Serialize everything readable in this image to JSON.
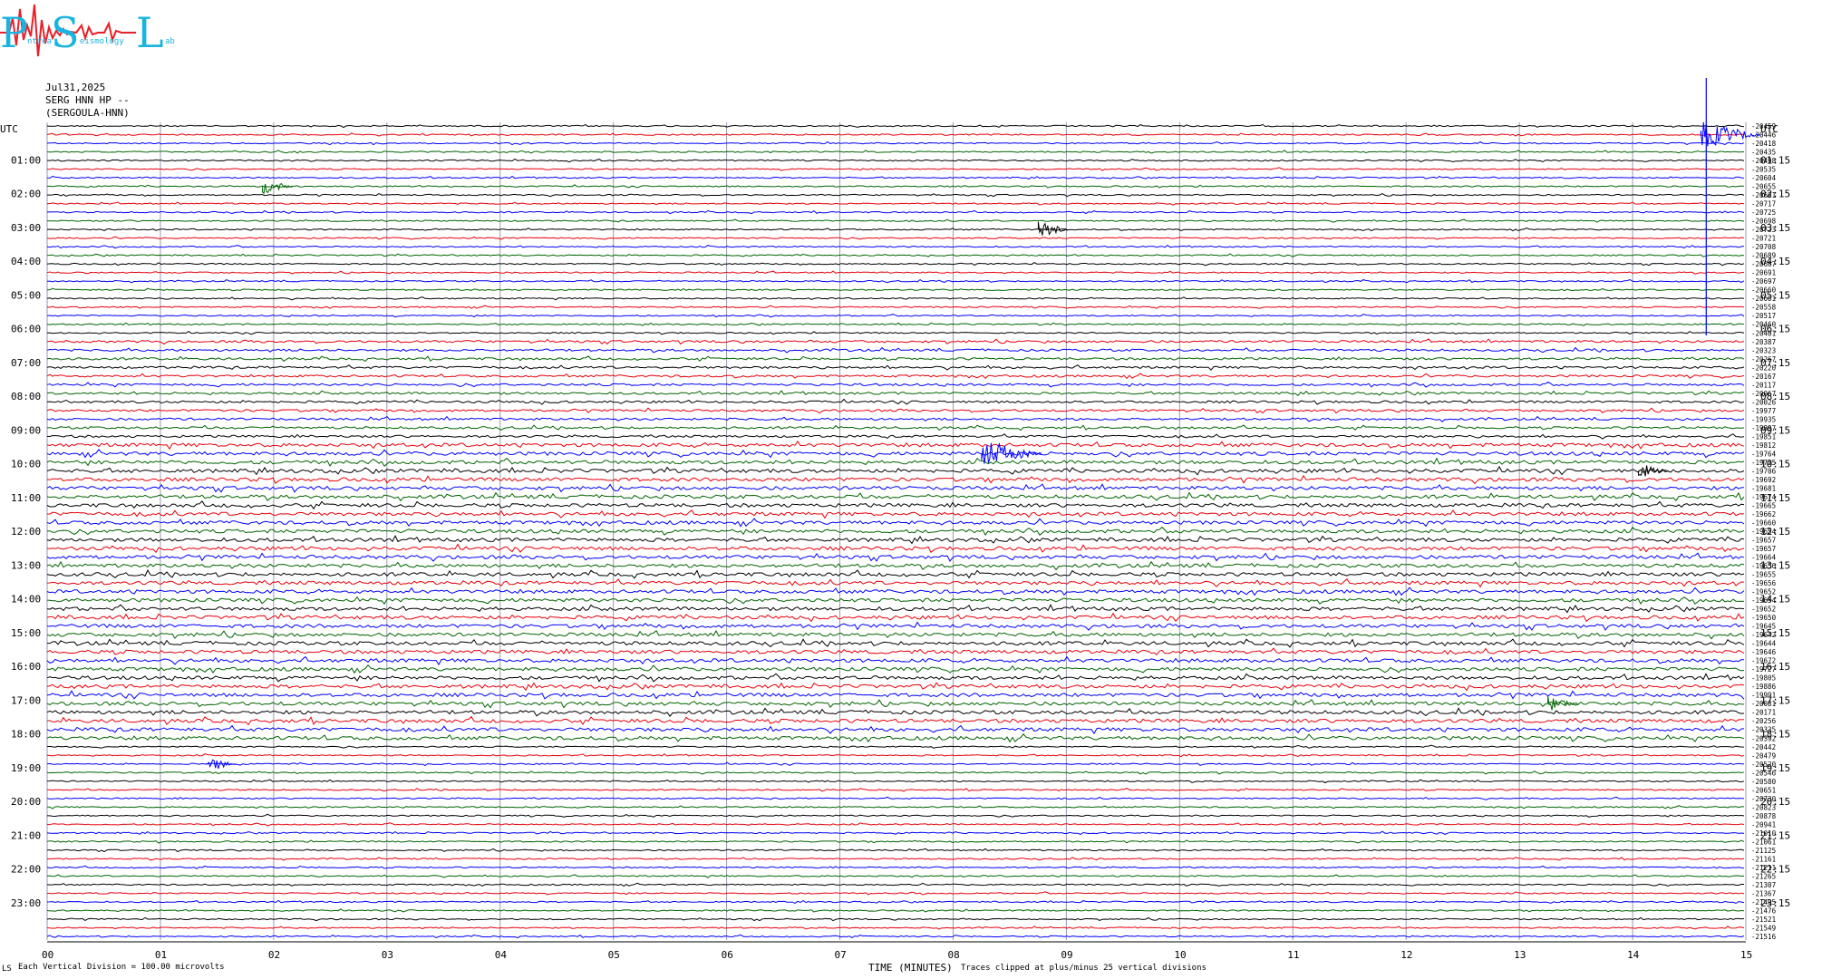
{
  "logo": {
    "letters": [
      "P",
      "S",
      "L"
    ],
    "fragments": [
      "ntrea",
      "eismology",
      "ab"
    ],
    "colors": {
      "letters": "#19b4e0",
      "trace": "#e8202a"
    }
  },
  "header": {
    "date": "Jul31,2025",
    "channel": "SERG HNN HP --",
    "station": "(SERGOULA-HNN)"
  },
  "chart_data": {
    "type": "line",
    "title": "",
    "left_axis_label": "UTC",
    "right_axis_label": "UTC",
    "xlabel": "TIME (MINUTES)",
    "x_ticks": [
      "00",
      "01",
      "02",
      "03",
      "04",
      "05",
      "06",
      "07",
      "08",
      "09",
      "10",
      "11",
      "12",
      "13",
      "14",
      "15"
    ],
    "xlim": [
      0,
      15
    ],
    "left_hour_labels": [
      "01:00",
      "02:00",
      "03:00",
      "04:00",
      "05:00",
      "06:00",
      "07:00",
      "08:00",
      "09:00",
      "10:00",
      "11:00",
      "12:00",
      "13:00",
      "14:00",
      "15:00",
      "16:00",
      "17:00",
      "18:00",
      "19:00",
      "20:00",
      "21:00",
      "22:00",
      "23:00"
    ],
    "right_hour_labels": [
      "01:15",
      "02:15",
      "03:15",
      "04:15",
      "05:15",
      "06:15",
      "07:15",
      "08:15",
      "09:15",
      "10:15",
      "11:15",
      "12:15",
      "13:15",
      "14:15",
      "15:15",
      "16:15",
      "17:15",
      "18:15",
      "19:15",
      "20:15",
      "21:15",
      "22:15",
      "23:15"
    ],
    "trace_colors": [
      "#000000",
      "#e8000b",
      "#0000ff",
      "#006400"
    ],
    "trace_offsets": [
      "-20459",
      "-20446",
      "-20418",
      "-20435",
      "-20498",
      "-20535",
      "-20604",
      "-20655",
      "-20691",
      "-20717",
      "-20725",
      "-20698",
      "-20723",
      "-20721",
      "-20708",
      "-20689",
      "-20667",
      "-20691",
      "-20697",
      "-20660",
      "-20601",
      "-20558",
      "-20517",
      "-20460",
      "-20401",
      "-20387",
      "-20323",
      "-20267",
      "-20220",
      "-20167",
      "-20117",
      "-20067",
      "-20026",
      "-19977",
      "-19935",
      "-19897",
      "-19851",
      "-19812",
      "-19764",
      "-19735",
      "-19706",
      "-19692",
      "-19681",
      "-19674",
      "-19665",
      "-19662",
      "-19660",
      "-19654",
      "-19657",
      "-19657",
      "-19664",
      "-19656",
      "-19655",
      "-19656",
      "-19652",
      "-19654",
      "-19652",
      "-19650",
      "-19645",
      "-19642",
      "-19644",
      "-19646",
      "-19672",
      "-19727",
      "-19805",
      "-19886",
      "-19991",
      "-20081",
      "-20171",
      "-20256",
      "-20335",
      "-20392",
      "-20442",
      "-20479",
      "-20520",
      "-20546",
      "-20580",
      "-20651",
      "-20730",
      "-20823",
      "-20878",
      "-20941",
      "-21010",
      "-21061",
      "-21125",
      "-21161",
      "-21211",
      "-21265",
      "-21307",
      "-21367",
      "-21405",
      "-21476",
      "-21521",
      "-21549",
      "-21516"
    ],
    "events": [
      {
        "trace": 1,
        "minute": 14.65,
        "amp": "large",
        "color": "blue"
      },
      {
        "trace": 7,
        "minute": 1.95,
        "amp": "medium"
      },
      {
        "trace": 12,
        "minute": 8.8,
        "amp": "medium"
      },
      {
        "trace": 38,
        "minute": 8.3,
        "amp": "large"
      },
      {
        "trace": 40,
        "minute": 14.1,
        "amp": "medium"
      },
      {
        "trace": 74,
        "minute": 1.45,
        "amp": "medium"
      },
      {
        "trace": 67,
        "minute": 13.3,
        "amp": "medium"
      }
    ]
  },
  "footer": {
    "scale_note": "Each Vertical Division =  100.00 microvolts",
    "clip_note": "Traces clipped at plus/minus 25 vertical divisions",
    "corner_mark": "LS"
  }
}
